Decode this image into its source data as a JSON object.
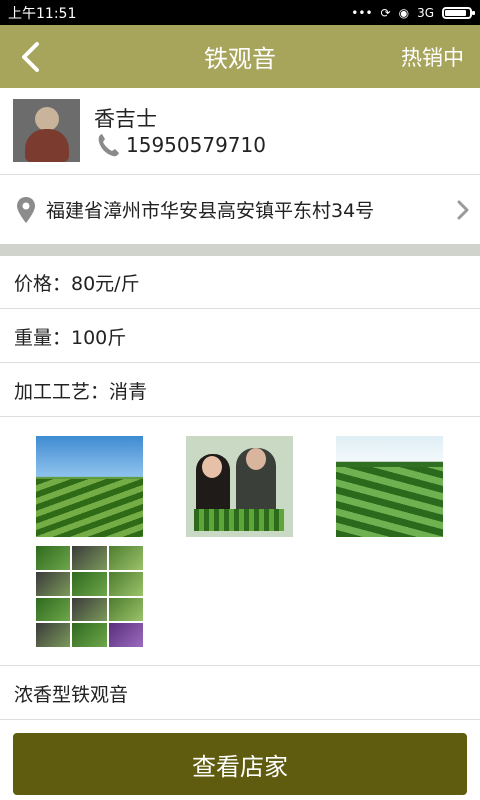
{
  "status_bar": {
    "time": "上午11:51",
    "signal_label": "3G"
  },
  "header": {
    "title": "铁观音",
    "right_label": "热销中"
  },
  "seller": {
    "name": "香吉士",
    "phone": "15950579710"
  },
  "address": {
    "text": "福建省漳州市华安县高安镇平东村34号"
  },
  "details": {
    "price": "价格：80元/斤",
    "weight": "重量：100斤",
    "process": "加工工艺：消青"
  },
  "description": "浓香型铁观音",
  "cta_label": "查看店家",
  "colors": {
    "header_bg": "#a7a45c",
    "cta_bg": "#605c0f",
    "divider_band": "#cfd3cc"
  },
  "battery_level": 0.8
}
